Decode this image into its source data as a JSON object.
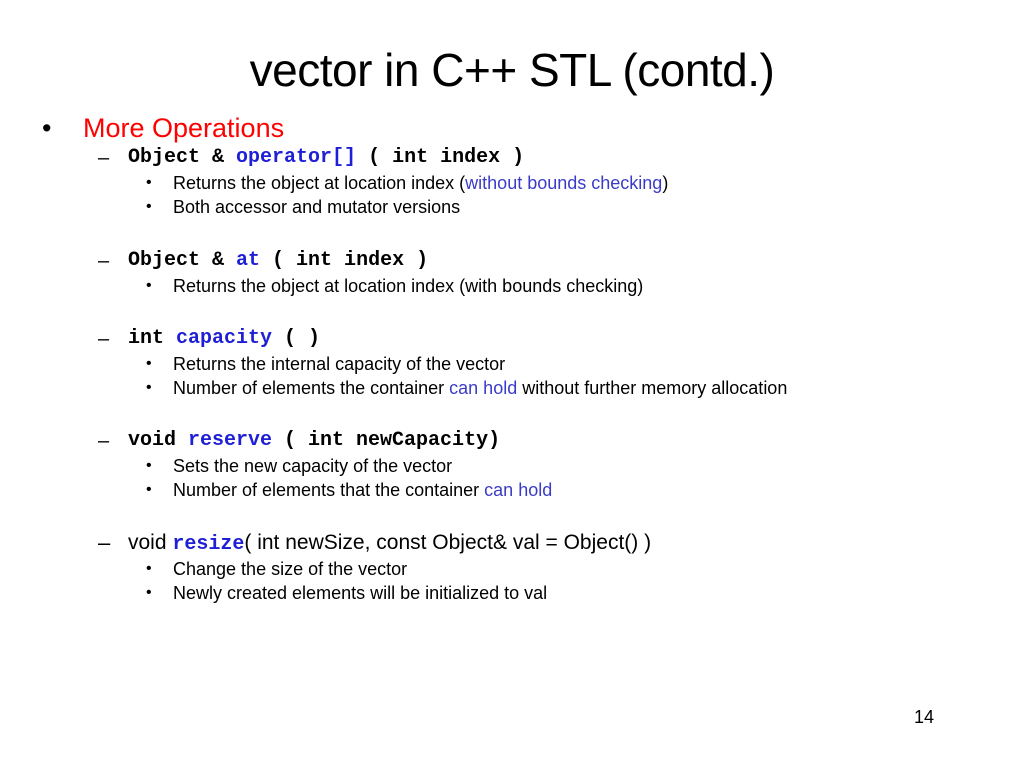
{
  "slide": {
    "title": "vector in C++ STL (contd.)",
    "page_number": "14",
    "heading_bullet": "•",
    "heading": "More Operations",
    "dash_symbol": "–",
    "sub_bullet": "•",
    "sections": [
      {
        "signature": {
          "prefix": "Object & ",
          "method": "operator[]",
          "suffix": " ( int index )"
        },
        "bullets": [
          {
            "pre": "Returns the object at location index (",
            "highlight": "without bounds checking",
            "post": ")"
          },
          {
            "pre": "Both accessor and mutator versions",
            "highlight": "",
            "post": ""
          }
        ]
      },
      {
        "signature": {
          "prefix": "Object & ",
          "method": "at",
          "suffix": " ( int index )"
        },
        "bullets": [
          {
            "pre": "Returns the object at location index (with bounds checking)",
            "highlight": "",
            "post": ""
          }
        ]
      },
      {
        "signature": {
          "prefix": "int ",
          "method": "capacity",
          "suffix": " ( )"
        },
        "bullets": [
          {
            "pre": "Returns the internal capacity of the vector",
            "highlight": "",
            "post": ""
          },
          {
            "pre": "Number of elements the container ",
            "highlight": "can hold",
            "post": " without further memory allocation"
          }
        ]
      },
      {
        "signature": {
          "prefix": "void ",
          "method": "reserve",
          "suffix": " ( int newCapacity)"
        },
        "bullets": [
          {
            "pre": "Sets the new capacity of the vector",
            "highlight": "",
            "post": ""
          },
          {
            "pre": "Number of elements that the container ",
            "highlight": "can hold",
            "post": ""
          }
        ]
      },
      {
        "signature": {
          "prefix": "void ",
          "method": "resize",
          "suffix": "( int newSize, const Object& val = Object() )"
        },
        "bullets": [
          {
            "pre": "Change the size of the vector",
            "highlight": "",
            "post": ""
          },
          {
            "pre": "Newly created elements will be initialized to val",
            "highlight": "",
            "post": ""
          }
        ]
      }
    ],
    "colors": {
      "heading": "#ff0000",
      "method_highlight": "#1f1fd6",
      "text_highlight": "#3b3bc8"
    }
  }
}
